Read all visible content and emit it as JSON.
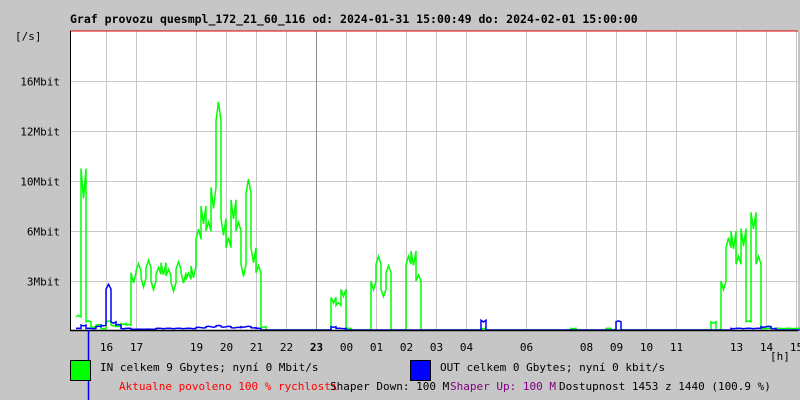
{
  "chart_data": {
    "type": "line",
    "title": "Graf provozu quesmpl_172_21_60_116 od: 2024-01-31 15:00:49 do: 2024-02-01 15:00:00",
    "ylabel": "[/s]",
    "xlabel": "[h]",
    "y_ticks": [
      {
        "label": "3Mbit",
        "value": 3
      },
      {
        "label": "6Mbit",
        "value": 6
      },
      {
        "label": "10Mbit",
        "value": 10
      },
      {
        "label": "12Mbit",
        "value": 12
      },
      {
        "label": "16Mbit",
        "value": 16
      }
    ],
    "x_ticks": [
      {
        "label": "16",
        "hour": 1
      },
      {
        "label": "17",
        "hour": 2
      },
      {
        "label": "19",
        "hour": 4
      },
      {
        "label": "20",
        "hour": 5
      },
      {
        "label": "21",
        "hour": 6
      },
      {
        "label": "22",
        "hour": 7
      },
      {
        "label": "23",
        "hour": 8,
        "bold": true
      },
      {
        "label": "00",
        "hour": 9
      },
      {
        "label": "01",
        "hour": 10
      },
      {
        "label": "02",
        "hour": 11
      },
      {
        "label": "03",
        "hour": 12
      },
      {
        "label": "04",
        "hour": 13
      },
      {
        "label": "06",
        "hour": 15
      },
      {
        "label": "08",
        "hour": 17
      },
      {
        "label": "09",
        "hour": 18
      },
      {
        "label": "10",
        "hour": 19
      },
      {
        "label": "11",
        "hour": 20
      },
      {
        "label": "13",
        "hour": 22
      },
      {
        "label": "14",
        "hour": 23
      },
      {
        "label": "15",
        "hour": 24
      }
    ],
    "x_range_hours": [
      0,
      24
    ],
    "bin_minutes": 10,
    "series": [
      {
        "name": "IN",
        "color": "#00ff00",
        "unit": "Mbit/s",
        "values": [
          0.8,
          10.5,
          0.5,
          0.2,
          0.3,
          0.1,
          0.5,
          0.3,
          0.2,
          0.4,
          0.3,
          3.5,
          3.6,
          3.2,
          3.8,
          3.0,
          3.4,
          4.1,
          3.3,
          2.9,
          3.7,
          3.5,
          3.1,
          3.9,
          5.5,
          8,
          6,
          9.5,
          12.8,
          7,
          5,
          8.5,
          6,
          4,
          9,
          5,
          3.5,
          0.2,
          0,
          0,
          0,
          0,
          0,
          0,
          0,
          0,
          0,
          0,
          0,
          0,
          0,
          2,
          1.5,
          2.5,
          0.1,
          0,
          0,
          0,
          0,
          3,
          4,
          2.5,
          3.5,
          0,
          0,
          0,
          4,
          4.8,
          3,
          0,
          0,
          0,
          0,
          0,
          0,
          0,
          0,
          0,
          0,
          0,
          0,
          0.1,
          0,
          0,
          0,
          0,
          0,
          0,
          0,
          0,
          0,
          0,
          0,
          0,
          0,
          0,
          0,
          0,
          0,
          0.1,
          0,
          0,
          0,
          0,
          0,
          0,
          0.1,
          0,
          0,
          0,
          0,
          0,
          0,
          0,
          0,
          0,
          0,
          0,
          0,
          0,
          0,
          0,
          0,
          0,
          0,
          0,
          0,
          0.5,
          0,
          3,
          5,
          6,
          4,
          6.2,
          0.5,
          7.5,
          4,
          0.1,
          0.1,
          0.1,
          0.1,
          0.1,
          0.1,
          0.1,
          0.1,
          0.1
        ]
      },
      {
        "name": "OUT",
        "color": "#0000ff",
        "unit": "kbit/s",
        "values": [
          0.1,
          0.3,
          0.1,
          0.1,
          0.2,
          0.3,
          2.5,
          0.5,
          0.3,
          0.1,
          0.1,
          0.05,
          0.05,
          0.05,
          0.05,
          0.05,
          0.1,
          0.1,
          0.1,
          0.1,
          0.1,
          0.1,
          0.1,
          0.1,
          0.15,
          0.15,
          0.2,
          0.2,
          0.25,
          0.2,
          0.2,
          0.15,
          0.15,
          0.2,
          0.2,
          0.15,
          0.1,
          0,
          0,
          0,
          0,
          0,
          0,
          0,
          0,
          0,
          0,
          0,
          0,
          0,
          0,
          0.2,
          0.1,
          0.1,
          0,
          0,
          0,
          0,
          0,
          0,
          0,
          0,
          0,
          0,
          0,
          0,
          0,
          0,
          0,
          0,
          0,
          0,
          0,
          0,
          0,
          0,
          0,
          0,
          0,
          0,
          0,
          0.6,
          0,
          0,
          0,
          0,
          0,
          0,
          0,
          0,
          0,
          0,
          0,
          0,
          0,
          0,
          0,
          0,
          0,
          0,
          0,
          0,
          0,
          0,
          0,
          0,
          0,
          0,
          0.5,
          0,
          0,
          0,
          0,
          0,
          0,
          0,
          0,
          0,
          0,
          0,
          0,
          0,
          0,
          0,
          0,
          0,
          0,
          0,
          0,
          0,
          0,
          0.1,
          0.1,
          0.1,
          0.1,
          0.1,
          0.1,
          0.2,
          0.2,
          0.1,
          0,
          0,
          0,
          0,
          0,
          0,
          0,
          0,
          0
        ]
      }
    ]
  },
  "legend": {
    "in_text": "IN celkem 9 Gbytes; nyní 0 Mbit/s",
    "out_text": "OUT celkem 0 Gbytes; nyní 0 kbit/s",
    "in_color": "#00ff00",
    "out_color": "#0000ff"
  },
  "footer": {
    "allowed": "Aktualne povoleno 100 % rychlosti",
    "shaper_down": "Shaper Down: 100 M",
    "shaper_up": "Shaper Up: 100 M",
    "availability": "Dostupnost 1453 z 1440 (100.9 %)"
  }
}
